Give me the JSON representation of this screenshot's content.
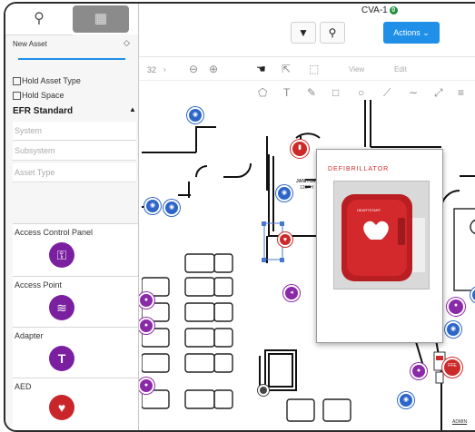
{
  "topbar": {
    "title": "CVA-1",
    "title_badge": "0",
    "filter_icon": "filter-icon",
    "search_icon": "search-icon",
    "actions_label": "Actions"
  },
  "toolbar1": {
    "zoom_value": "32",
    "view_label": "View",
    "edit_label": "Edit"
  },
  "panel": {
    "new_asset_label": "New Asset",
    "hold_asset_type": "Hold Asset Type",
    "hold_space": "Hold Space",
    "section_title": "EFR Standard",
    "fields": {
      "system": "System",
      "subsystem": "Subsystem",
      "asset_type": "Asset Type"
    },
    "cards": [
      {
        "label": "Access Control Panel",
        "icon": "access-control-panel-icon"
      },
      {
        "label": "Access Point",
        "icon": "wifi-icon"
      },
      {
        "label": "Adapter",
        "icon": "adapter-icon"
      },
      {
        "label": "AED",
        "icon": "heart-icon"
      }
    ]
  },
  "plan": {
    "room_label": "JANITOR",
    "room_area": "120FH",
    "admin_label": "ADMIN"
  },
  "popup": {
    "header_text": "DEFIBRILLATOR",
    "device_text": "HEARTSTART"
  },
  "colors": {
    "accent": "#1f8fe8",
    "purple": "#7a1fa0",
    "red": "#c9262c",
    "blue_marker": "#2d66c8"
  }
}
